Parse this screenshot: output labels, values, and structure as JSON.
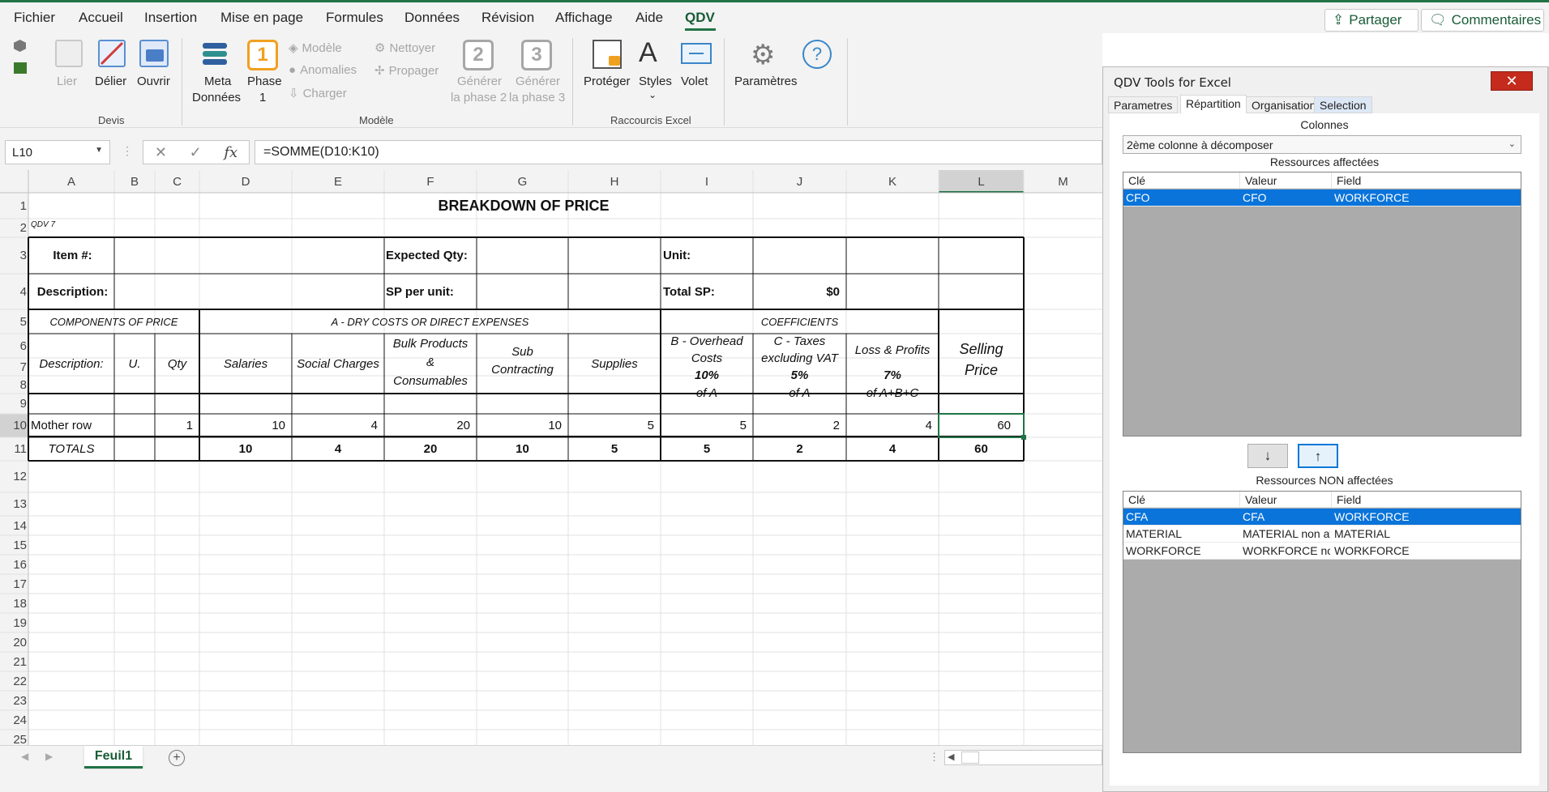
{
  "menu": {
    "tabs": [
      "Fichier",
      "Accueil",
      "Insertion",
      "Mise en page",
      "Formules",
      "Données",
      "Révision",
      "Affichage",
      "Aide",
      "QDV"
    ],
    "active_tab": "QDV",
    "share_label": "Partager",
    "comments_label": "Commentaires"
  },
  "ribbon": {
    "devis": {
      "lier": "Lier",
      "delier": "Délier",
      "ouvrir": "Ouvrir",
      "group": "Devis"
    },
    "modele": {
      "meta_line1": "Meta",
      "meta_line2": "Données",
      "phase1_line1": "Phase",
      "phase1_line2": "1",
      "modele": "Modèle",
      "anomalies": "Anomalies",
      "charger": "Charger",
      "nettoyer": "Nettoyer",
      "propager": "Propager",
      "gen2_line1": "Générer",
      "gen2_line2": "la phase 2",
      "gen3_line1": "Générer",
      "gen3_line2": "la phase 3",
      "phase1_num": "1",
      "phase2_num": "2",
      "phase3_num": "3",
      "group": "Modèle"
    },
    "raccourcis": {
      "proteger": "Protéger",
      "styles": "Styles",
      "volet": "Volet",
      "group": "Raccourcis Excel"
    },
    "parametres": "Paramètres"
  },
  "formula_bar": {
    "name_box": "L10",
    "formula": "=SOMME(D10:K10)",
    "fx": "fx"
  },
  "grid": {
    "columns": [
      "A",
      "B",
      "C",
      "D",
      "E",
      "F",
      "G",
      "H",
      "I",
      "J",
      "K",
      "L",
      "M"
    ],
    "rows": [
      "1",
      "2",
      "3",
      "4",
      "5",
      "6",
      "7",
      "8",
      "9",
      "10",
      "11",
      "12",
      "13",
      "14",
      "15",
      "16",
      "17",
      "18",
      "19",
      "20",
      "21",
      "22",
      "23",
      "24",
      "25"
    ],
    "title": "BREAKDOWN OF PRICE",
    "qdv_tag": "QDV 7",
    "item_label": "Item #:",
    "expected_qty_label": "Expected Qty:",
    "unit_label": "Unit:",
    "description_label": "Description:",
    "sp_per_unit_label": "SP per unit:",
    "total_sp_label": "Total SP:",
    "total_sp_value": "$0",
    "components_header": "COMPONENTS OF PRICE",
    "dry_costs_header": "A - DRY COSTS OR DIRECT EXPENSES",
    "coefficients_header": "COEFFICIENTS",
    "col_description": "Description:",
    "col_unit": "U.",
    "col_qty": "Qty",
    "col_salaries": "Salaries",
    "col_social": "Social Charges",
    "col_bulk_1": "Bulk Products",
    "col_bulk_2": "&",
    "col_bulk_3": "Consumables",
    "col_sub_1": "Sub",
    "col_sub_2": "Contracting",
    "col_supplies": "Supplies",
    "col_overhead_1": "B - Overhead",
    "col_overhead_2": "Costs",
    "col_overhead_pct": "10%",
    "col_overhead_of": "of A",
    "col_taxes_1": "C - Taxes",
    "col_taxes_2": "excluding VAT",
    "col_taxes_pct": "5%",
    "col_taxes_of": "of A",
    "col_loss": "Loss & Profits",
    "col_loss_pct": "7%",
    "col_loss_of": "of A+B+C",
    "col_selling_1": "Selling",
    "col_selling_2": "Price",
    "mother_row": {
      "label": "Mother row",
      "qty": "1",
      "salaries": "10",
      "social": "4",
      "bulk": "20",
      "sub": "10",
      "supplies": "5",
      "overhead": "5",
      "taxes": "2",
      "loss": "4",
      "selling": "60"
    },
    "totals": {
      "label": "TOTALS",
      "salaries": "10",
      "social": "4",
      "bulk": "20",
      "sub": "10",
      "supplies": "5",
      "overhead": "5",
      "taxes": "2",
      "loss": "4",
      "selling": "60"
    }
  },
  "sheet_tabs": {
    "active": "Feuil1",
    "add": "+"
  },
  "panel": {
    "title": "QDV Tools for Excel",
    "close": "✕",
    "tabs": [
      "Parametres",
      "Répartition",
      "Organisation",
      "Selection"
    ],
    "active_tab": "Répartition",
    "colonnes_label": "Colonnes",
    "combo_value": "2ème colonne à décomposer",
    "affectees_label": "Ressources affectées",
    "non_affectees_label": "Ressources NON affectées",
    "headers": [
      "Clé",
      "Valeur",
      "Field"
    ],
    "affectees_rows": [
      {
        "cle": "CFO",
        "valeur": "CFO",
        "field": "WORKFORCE"
      }
    ],
    "non_affectees_rows": [
      {
        "cle": "CFA",
        "valeur": "CFA",
        "field": "WORKFORCE"
      },
      {
        "cle": "MATERIAL",
        "valeur": "MATERIAL non aff...",
        "field": "MATERIAL"
      },
      {
        "cle": "WORKFORCE",
        "valeur": "WORKFORCE no...",
        "field": "WORKFORCE"
      }
    ],
    "down_arrow": "↓",
    "up_arrow": "↑"
  },
  "colors": {
    "excel_green": "#217346",
    "selection_blue": "#0a74da",
    "close_red": "#c42b1c"
  }
}
